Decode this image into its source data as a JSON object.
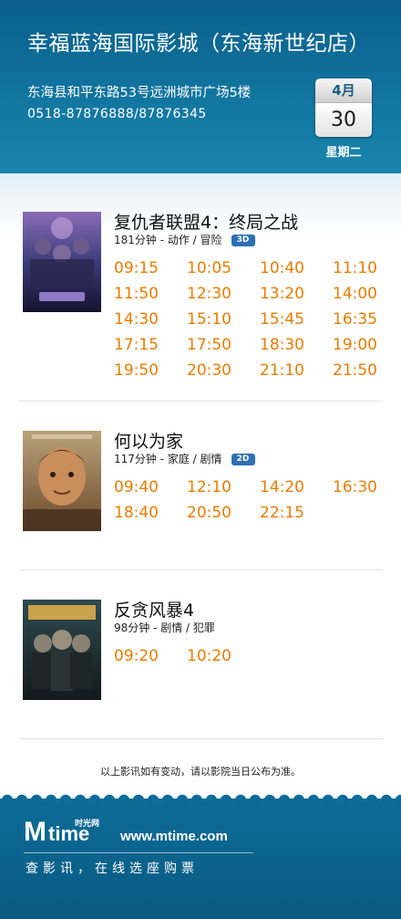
{
  "cinema": {
    "name": "幸福蓝海国际影城（东海新世纪店）",
    "address": "东海县和平东路53号远洲城市广场5楼",
    "phone": "0518-87876888/87876345"
  },
  "date": {
    "month": "4月",
    "day": "30",
    "weekday": "星期二"
  },
  "movies": [
    {
      "title": "复仇者联盟4：终局之战",
      "meta": "181分钟 - 动作 / 冒险",
      "format": "3D",
      "times": [
        "09:15",
        "10:05",
        "10:40",
        "11:10",
        "11:50",
        "12:30",
        "13:20",
        "14:00",
        "14:30",
        "15:10",
        "15:45",
        "16:35",
        "17:15",
        "17:50",
        "18:30",
        "19:00",
        "19:50",
        "20:30",
        "21:10",
        "21:50"
      ]
    },
    {
      "title": "何以为家",
      "meta": "117分钟 - 家庭 / 剧情",
      "format": "2D",
      "times": [
        "09:40",
        "12:10",
        "14:20",
        "16:30",
        "18:40",
        "20:50",
        "22:15"
      ]
    },
    {
      "title": "反贪风暴4",
      "meta": "98分钟 - 剧情 / 犯罪",
      "format": "",
      "times": [
        "09:20",
        "10:20"
      ]
    }
  ],
  "footnote": "以上影讯如有变动，请以影院当日公布为准。",
  "footer": {
    "logo_m": "M",
    "logo_time": "time",
    "logo_cn": "时光网",
    "site": "www.mtime.com",
    "slogan": "查影讯，在线选座购票"
  },
  "colors": {
    "header_blue": "#0a5f8c",
    "showtime_orange": "#e87b00",
    "badge_blue": "#2d6fb3"
  }
}
